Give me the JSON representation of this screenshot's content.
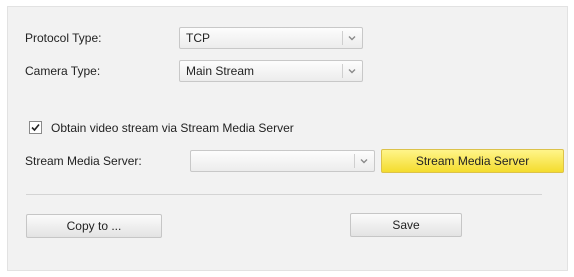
{
  "form": {
    "protocol_type": {
      "label": "Protocol Type:",
      "value": "TCP"
    },
    "camera_type": {
      "label": "Camera Type:",
      "value": "Main Stream"
    },
    "stream_option": {
      "label": "Obtain video stream via Stream Media Server",
      "checked": true
    },
    "stream_server": {
      "label": "Stream Media Server:",
      "value": "",
      "button_label": "Stream Media Server"
    }
  },
  "actions": {
    "copy_label": "Copy to ...",
    "save_label": "Save"
  },
  "icons": {
    "dropdown": "chevron-down-icon",
    "check": "checkmark-icon"
  },
  "colors": {
    "panel_bg": "#f2f2f2",
    "highlight_button": "#f8e64a"
  }
}
